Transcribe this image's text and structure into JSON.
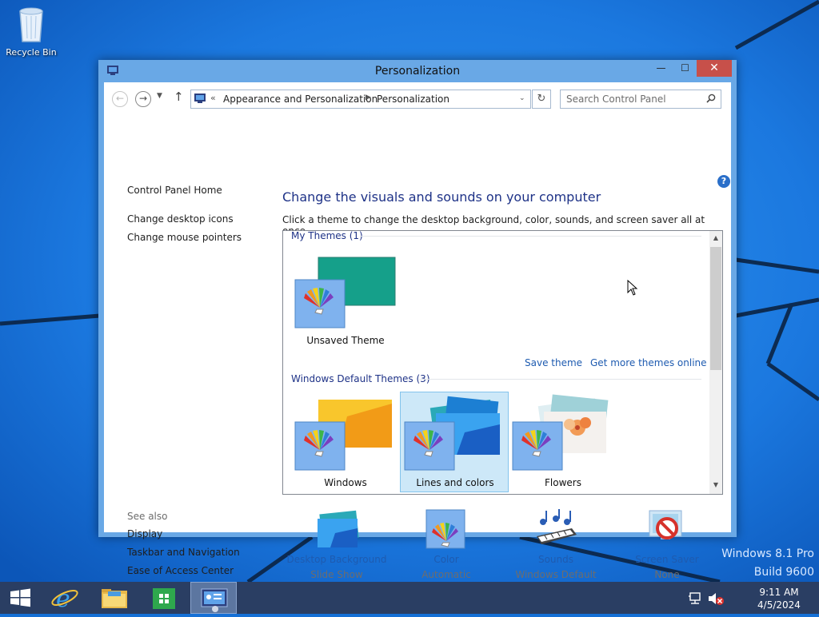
{
  "desktop": {
    "recycle_bin_label": "Recycle Bin",
    "watermark_line1": "Windows 8.1 Pro",
    "watermark_line2": "Build 9600"
  },
  "window": {
    "title": "Personalization",
    "min_glyph": "—",
    "max_glyph": "☐",
    "close_glyph": "✕"
  },
  "navigation": {
    "back_glyph": "←",
    "forward_glyph": "→",
    "dropdown_glyph": "▼",
    "up_glyph": "↑",
    "address_chevron": "«",
    "breadcrumb": [
      "Appearance and Personalization",
      "Personalization"
    ],
    "crumb_separator": "▶",
    "address_dropdown_glyph": "⌄",
    "refresh_glyph": "↻",
    "search_placeholder": "Search Control Panel"
  },
  "help_glyph": "?",
  "left_pane": {
    "links": [
      "Control Panel Home",
      "Change desktop icons",
      "Change mouse pointers"
    ],
    "see_also_label": "See also",
    "see_also_links": [
      "Display",
      "Taskbar and Navigation",
      "Ease of Access Center"
    ]
  },
  "main": {
    "heading": "Change the visuals and sounds on your computer",
    "description": "Click a theme to change the desktop background, color, sounds, and screen saver all at once.",
    "my_themes_header": "My Themes (1)",
    "unsaved_theme_label": "Unsaved Theme",
    "save_theme_link": "Save theme",
    "get_more_link": "Get more themes online",
    "default_themes_header": "Windows Default Themes (3)",
    "themes": [
      "Windows",
      "Lines and colors",
      "Flowers"
    ],
    "selected_theme": "Lines and colors"
  },
  "settings": [
    {
      "label": "Desktop Background",
      "value": "Slide Show",
      "icon": "desktop-background-icon"
    },
    {
      "label": "Color",
      "value": "Automatic",
      "icon": "color-icon"
    },
    {
      "label": "Sounds",
      "value": "Windows Default",
      "icon": "sounds-icon"
    },
    {
      "label": "Screen Saver",
      "value": "None",
      "icon": "screen-saver-icon"
    }
  ],
  "taskbar": {
    "time": "9:11 AM",
    "date": "4/5/2024"
  },
  "colors": {
    "desktop": "#1570d6",
    "window_frame": "#69a8e6",
    "link": "#1e5bb0",
    "heading": "#1e3287",
    "taskbar": "#2a3e63",
    "close_button": "#c7504a"
  }
}
